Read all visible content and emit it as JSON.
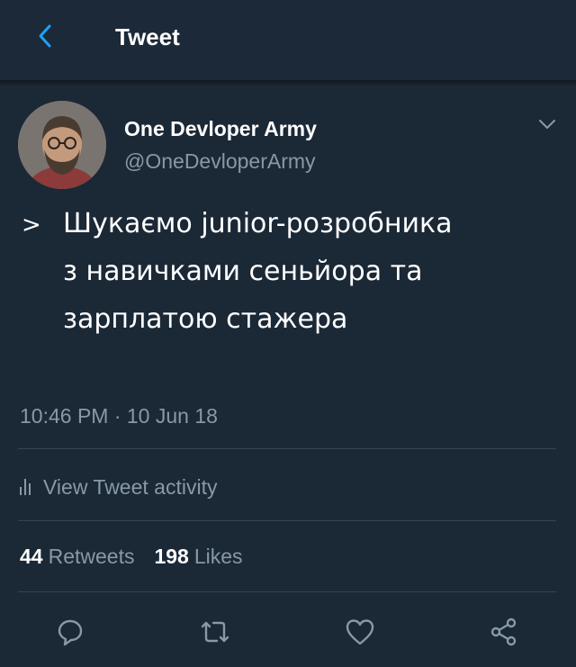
{
  "header": {
    "title": "Tweet",
    "back_icon": "chevron-left-icon",
    "accent": "#1da1f2"
  },
  "user": {
    "name": "One Devloper Army",
    "handle": "@OneDevloperArmy"
  },
  "tweet": {
    "quote_mark": ">",
    "lines": [
      "Шукаємо junior-розробника",
      "з навичками сеньйора та",
      "зарплатою стажера"
    ],
    "timestamp": "10:46 PM · 10 Jun 18"
  },
  "activity": {
    "label": "View Tweet activity",
    "icon": "bar-chart-icon"
  },
  "stats": {
    "retweets_count": "44",
    "retweets_label": "Retweets",
    "likes_count": "198",
    "likes_label": "Likes"
  },
  "actions": [
    "reply-icon",
    "retweet-icon",
    "like-icon",
    "share-icon"
  ],
  "colors": {
    "background": "#1b2836",
    "text": "#ffffff",
    "muted": "#8899a6",
    "divider": "#38444d"
  }
}
